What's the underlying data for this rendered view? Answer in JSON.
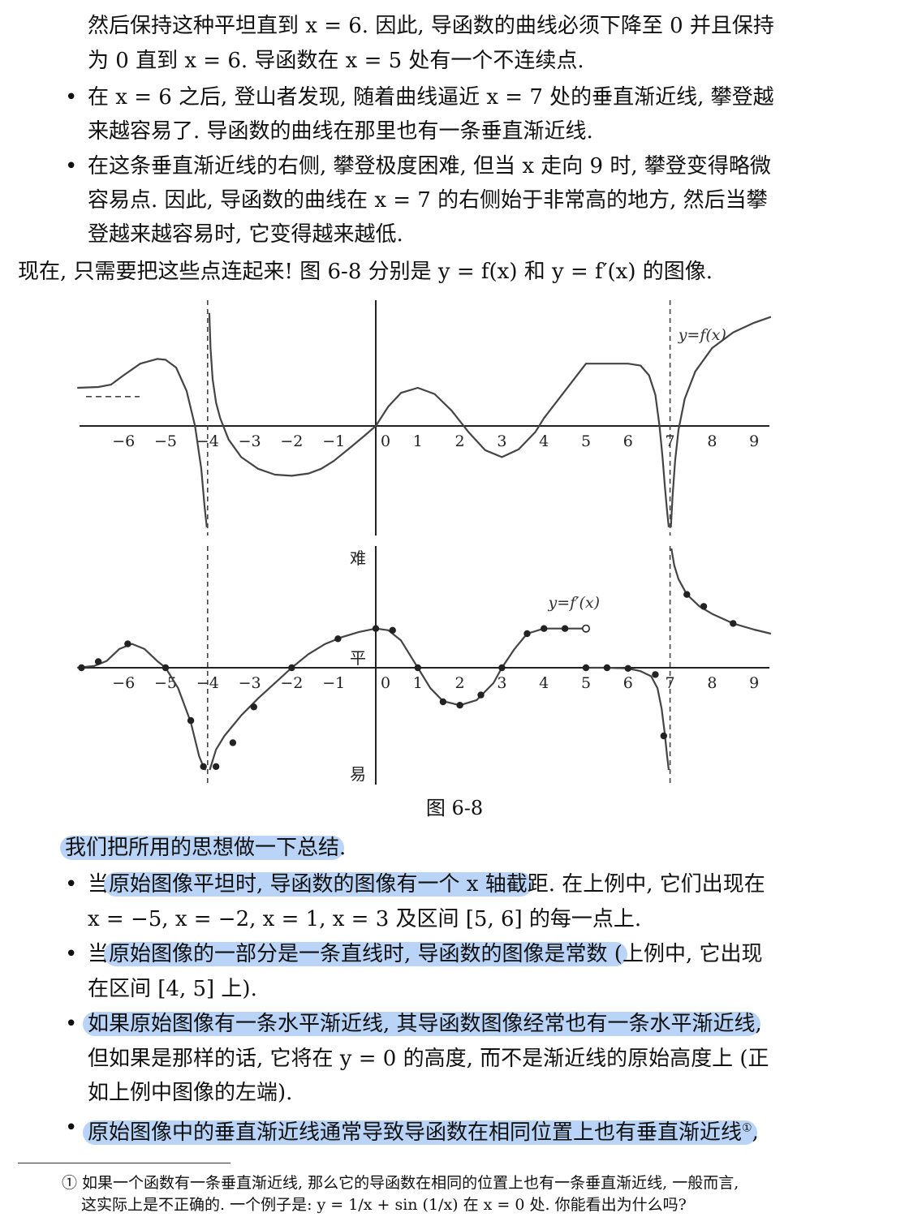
{
  "text": {
    "p1_l1": "然后保持这种平坦直到 x = 6. 因此, 导函数的曲线必须下降至 0 并且保持",
    "p1_l2": "为 0 直到 x = 6. 导函数在 x = 5 处有一个不连续点.",
    "b1_l1": "在 x = 6 之后, 登山者发现, 随着曲线逼近 x = 7 处的垂直渐近线, 攀登越",
    "b1_l2": "来越容易了. 导函数的曲线在那里也有一条垂直渐近线.",
    "b2_l1": "在这条垂直渐近线的右侧, 攀登极度困难, 但当 x 走向 9 时, 攀登变得略微",
    "b2_l2": "容易点. 因此, 导函数的曲线在 x = 7 的右侧始于非常高的地方, 然后当攀",
    "b2_l3": "登越来越容易时, 它变得越来越低.",
    "p2": "现在, 只需要把这些点连起来! 图 6-8 分别是 y = f(x) 和 y = f′(x) 的图像.",
    "caption": "图    6-8",
    "summary": "我们把所用的思想做一下总结",
    "summary_end": ".",
    "s1_pre": "当",
    "s1_hl": "原始图像平坦时, 导函数的图像有一个 x 轴截",
    "s1_post": "距. 在上例中, 它们出现在",
    "s1_l2": "x = −5, x = −2, x = 1, x = 3 及区间 [5, 6] 的每一点上.",
    "s2_pre": "当",
    "s2_hl": "原始图像的一部分是一条直线时, 导函数的图像是常数 (",
    "s2_post": "上例中, 它出现",
    "s2_l2": "在区间 [4, 5] 上).",
    "s3_hl": "如果原始图像有一条水平渐近线, 其导函数图像经常也有一条水平渐近线",
    "s3_post": ",",
    "s3_l2": "但如果是那样的话, 它将在 y = 0 的高度, 而不是渐近线的原始高度上 (正",
    "s3_l3": "如上例中图像的左端).",
    "s4_hl": "原始图像中的垂直渐近线通常导致导函数在相同位置上也有垂直渐近线",
    "s4_sup": "①",
    "s4_post": ",",
    "fn_l1": "① 如果一个函数有一条垂直渐近线, 那么它的导函数在相同的位置上也有一条垂直渐近线, 一般而言,",
    "fn_l2": "这实际上是不正确的. 一个例子是: y = 1/x + sin (1/x) 在 x = 0 处. 你能看出为什么吗?",
    "bullet": "•"
  },
  "colors": {
    "highlight": "#b9d4f7",
    "curve": "#444444",
    "axis": "#222222"
  },
  "chart_data": [
    {
      "type": "line",
      "series": [
        {
          "name": "y=f(x)"
        }
      ],
      "curve_label": "y=f(x)",
      "x_ticks": [
        "−6",
        "−5",
        "−4",
        "−3",
        "−2",
        "−1",
        "0",
        "1",
        "2",
        "3",
        "4",
        "5",
        "6",
        "7",
        "8",
        "9"
      ],
      "xlim": [
        -7.1,
        9.4
      ],
      "ylim": [
        -2.6,
        2.9
      ],
      "vertical_asymptotes": [
        -4,
        7
      ],
      "horizontal_asymptote_left": 0.9,
      "segments": [
        {
          "x": [
            -7.1,
            -6.6,
            -6.3,
            -6.0,
            -5.6,
            -5.2,
            -5.0,
            -4.75,
            -4.5,
            -4.3,
            -4.15,
            -4.07,
            -4.02
          ],
          "y": [
            0.98,
            1.0,
            1.06,
            1.3,
            1.6,
            1.72,
            1.7,
            1.5,
            0.9,
            0.0,
            -1.1,
            -2.1,
            -2.6
          ]
        },
        {
          "x": [
            -3.96,
            -3.93,
            -3.88,
            -3.8,
            -3.7,
            -3.5,
            -3.2,
            -2.8,
            -2.4,
            -2.0,
            -1.6,
            -1.3,
            -1.0,
            -0.6,
            -0.3,
            0.0
          ],
          "y": [
            2.9,
            2.0,
            1.2,
            0.6,
            0.2,
            -0.35,
            -0.8,
            -1.1,
            -1.25,
            -1.28,
            -1.22,
            -1.1,
            -0.9,
            -0.55,
            -0.28,
            0.0
          ]
        },
        {
          "x": [
            0.0,
            0.3,
            0.6,
            1.0,
            1.4,
            1.8,
            2.2,
            2.6,
            3.0,
            3.4,
            3.8,
            4.0,
            5.0,
            5.6,
            6.0,
            6.3,
            6.5,
            6.65,
            6.75,
            6.82,
            6.88,
            6.93,
            6.97
          ],
          "y": [
            0.0,
            0.5,
            0.85,
            0.98,
            0.82,
            0.4,
            -0.15,
            -0.62,
            -0.8,
            -0.6,
            -0.15,
            0.2,
            1.6,
            1.6,
            1.6,
            1.55,
            1.3,
            0.8,
            0.0,
            -0.8,
            -1.6,
            -2.2,
            -2.6
          ]
        },
        {
          "x": [
            7.02,
            7.06,
            7.12,
            7.2,
            7.35,
            7.6,
            8.0,
            8.5,
            9.0,
            9.4
          ],
          "y": [
            -2.6,
            -1.8,
            -0.9,
            -0.1,
            0.7,
            1.4,
            2.0,
            2.4,
            2.65,
            2.8
          ]
        }
      ]
    },
    {
      "type": "line",
      "series": [
        {
          "name": "y=f′(x)"
        }
      ],
      "curve_label": "y=f′(x)",
      "y_labels": [
        "难",
        "平",
        "易"
      ],
      "x_ticks": [
        "−6",
        "−5",
        "−4",
        "−3",
        "−2",
        "−1",
        "0",
        "1",
        "2",
        "3",
        "4",
        "5",
        "6",
        "7",
        "8",
        "9"
      ],
      "xlim": [
        -7.1,
        9.4
      ],
      "ylim": [
        -3.0,
        3.5
      ],
      "vertical_asymptotes": [
        -4,
        7
      ],
      "segments": [
        {
          "x": [
            -7.1,
            -6.7,
            -6.4,
            -6.1,
            -5.8,
            -5.5,
            -5.2,
            -5.0,
            -4.7,
            -4.4,
            -4.2,
            -4.1,
            -4.05
          ],
          "y": [
            0.0,
            0.05,
            0.2,
            0.55,
            0.7,
            0.55,
            0.2,
            0.0,
            -0.6,
            -1.6,
            -2.6,
            -2.9,
            -3.0
          ]
        },
        {
          "x": [
            -3.95,
            -3.8,
            -3.6,
            -3.2,
            -2.8,
            -2.4,
            -2.0,
            -1.6,
            -1.2,
            -0.8,
            -0.4,
            0.0,
            0.3,
            0.6,
            1.0,
            1.3,
            1.6,
            2.0,
            2.4,
            2.8,
            3.0,
            3.3,
            3.6,
            4.0,
            4.5,
            5.0
          ],
          "y": [
            -3.0,
            -2.4,
            -2.0,
            -1.4,
            -0.9,
            -0.45,
            0.0,
            0.4,
            0.7,
            0.9,
            1.05,
            1.15,
            1.1,
            0.8,
            0.0,
            -0.6,
            -0.98,
            -1.1,
            -0.95,
            -0.45,
            0.0,
            0.55,
            1.0,
            1.15,
            1.15,
            1.15
          ]
        },
        {
          "x": [
            5.0,
            5.5,
            6.0,
            6.3,
            6.55,
            6.7,
            6.8,
            6.87,
            6.93,
            6.97
          ],
          "y": [
            0.0,
            0.0,
            -0.02,
            -0.1,
            -0.25,
            -0.6,
            -1.2,
            -1.9,
            -2.6,
            -3.0
          ]
        },
        {
          "x": [
            7.03,
            7.1,
            7.2,
            7.4,
            7.7,
            8.0,
            8.5,
            9.0,
            9.4
          ],
          "y": [
            3.5,
            3.0,
            2.6,
            2.15,
            1.8,
            1.58,
            1.3,
            1.12,
            1.0
          ]
        }
      ],
      "points": [
        [
          -7.0,
          0.0
        ],
        [
          -6.6,
          0.18
        ],
        [
          -5.9,
          0.7
        ],
        [
          -5.0,
          0.0
        ],
        [
          -4.4,
          -1.55
        ],
        [
          -4.1,
          -2.9
        ],
        [
          -3.8,
          -2.9
        ],
        [
          -3.4,
          -2.2
        ],
        [
          -2.9,
          -1.15
        ],
        [
          -2.0,
          0.0
        ],
        [
          -0.9,
          0.85
        ],
        [
          0.0,
          1.15
        ],
        [
          0.4,
          1.1
        ],
        [
          1.0,
          0.0
        ],
        [
          1.6,
          -1.0
        ],
        [
          2.0,
          -1.1
        ],
        [
          2.5,
          -0.8
        ],
        [
          3.0,
          0.0
        ],
        [
          3.6,
          1.0
        ],
        [
          4.0,
          1.15
        ],
        [
          4.5,
          1.15
        ],
        [
          5.0,
          0.0
        ],
        [
          5.5,
          0.0
        ],
        [
          6.0,
          -0.02
        ],
        [
          6.65,
          -0.2
        ],
        [
          6.85,
          -2.0
        ],
        [
          7.4,
          2.15
        ],
        [
          7.8,
          1.8
        ],
        [
          8.5,
          1.3
        ]
      ],
      "open_points": [
        [
          5.0,
          1.15
        ]
      ]
    }
  ]
}
